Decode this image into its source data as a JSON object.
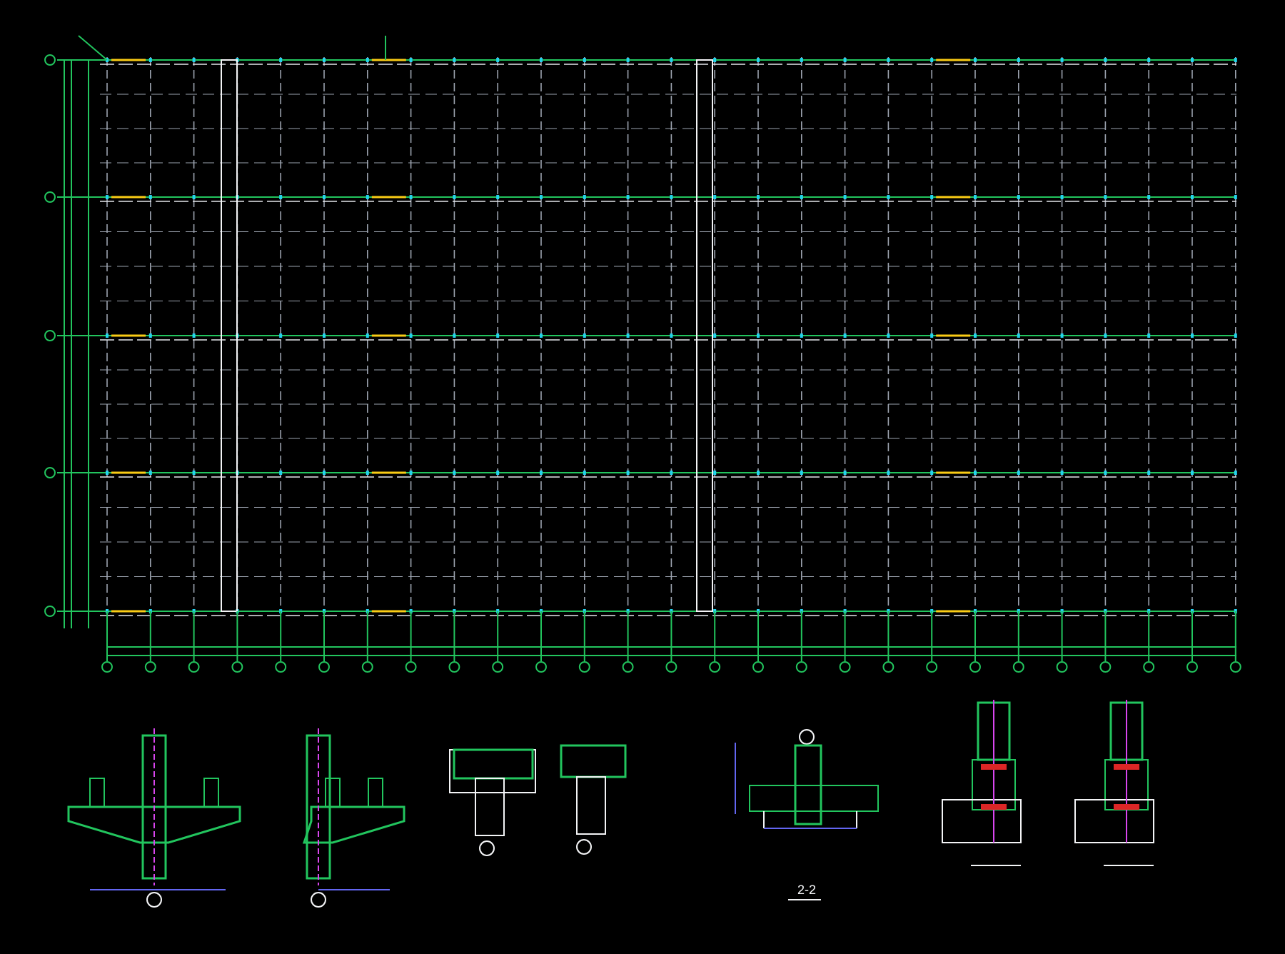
{
  "details": {
    "section_label": "2-2"
  }
}
